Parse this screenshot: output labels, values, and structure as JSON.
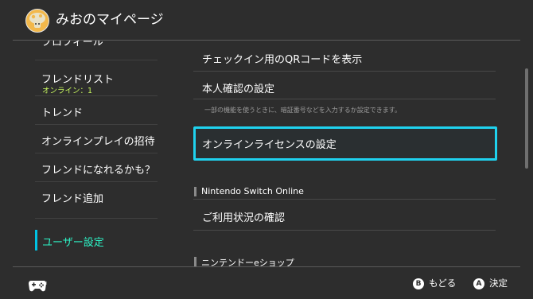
{
  "header": {
    "title": "みおのマイページ",
    "avatar_icon": "mushroom-avatar-icon"
  },
  "sidebar": {
    "items": [
      {
        "label": "プロフィール"
      },
      {
        "label": "フレンドリスト",
        "sublabel": "オンライン：1"
      },
      {
        "label": "トレンド"
      },
      {
        "label": "オンラインプレイの招待"
      },
      {
        "label": "フレンドになれるかも？"
      },
      {
        "label": "フレンド追加"
      },
      {
        "label": "ユーザー設定",
        "active": true
      }
    ]
  },
  "content": {
    "qr_label": "チェックイン用のQRコードを表示",
    "identity_label": "本人確認の設定",
    "identity_desc": "一部の機能を使うときに、暗証番号などを入力するか設定できます。",
    "license_label": "オンラインライセンスの設定",
    "section_nso": "Nintendo Switch Online",
    "usage_label": "ご利用状況の確認",
    "section_eshop": "ニンテンドーeショップ"
  },
  "footer": {
    "back_key": "B",
    "back_label": "もどる",
    "ok_key": "A",
    "ok_label": "決定"
  },
  "colors": {
    "accent": "#1fd2ee",
    "active_text": "#2df5c8",
    "online": "#c7f65f",
    "background": "#2d2d2d"
  }
}
